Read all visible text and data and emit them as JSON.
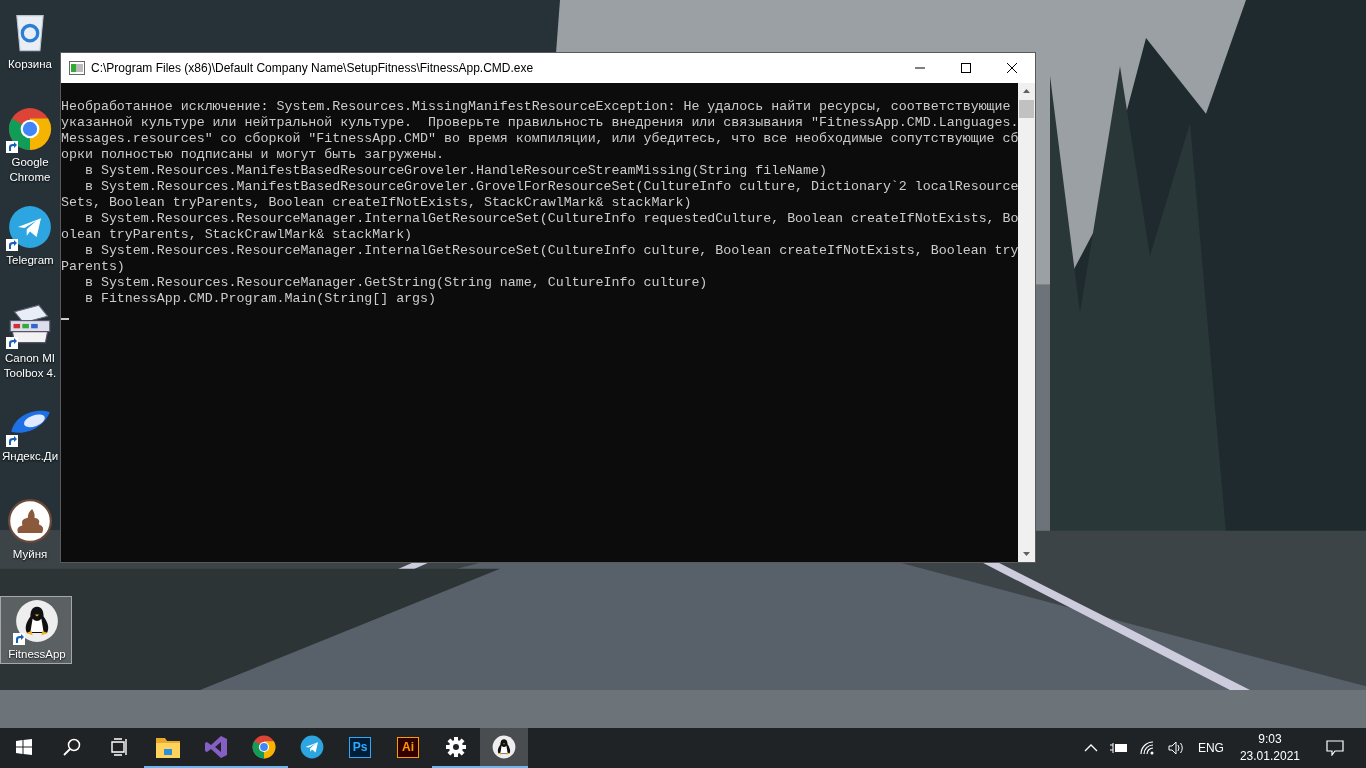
{
  "desktop_icons": [
    {
      "kind": "recycle-bin",
      "label": "Корзина",
      "shortcut": false,
      "selected": false
    },
    {
      "kind": "chrome",
      "label": "Google Chrome",
      "shortcut": true,
      "selected": false
    },
    {
      "kind": "telegram",
      "label": "Telegram",
      "shortcut": true,
      "selected": false
    },
    {
      "kind": "scanner",
      "label": "Canon MI Toolbox 4.",
      "shortcut": true,
      "selected": false
    },
    {
      "kind": "saucer",
      "label": "Яндекс.Ди",
      "shortcut": true,
      "selected": false
    },
    {
      "kind": "poop",
      "label": "Муйня",
      "shortcut": false,
      "selected": false
    },
    {
      "kind": "penguin",
      "label": "FitnessApp",
      "shortcut": true,
      "selected": true
    }
  ],
  "window": {
    "title": "C:\\Program Files (x86)\\Default Company Name\\SetupFitness\\FitnessApp.CMD.exe"
  },
  "console": {
    "lines": [
      "Необработанное исключение: System.Resources.MissingManifestResourceException: Не удалось найти ресурсы, соответствующие",
      "указанной культуре или нейтральной культуре.  Проверьте правильность внедрения или связывания \"FitnessApp.CMD.Languages.",
      "Messages.resources\" со сборкой \"FitnessApp.CMD\" во время компиляции, или убедитесь, что все необходимые сопутствующие сб",
      "орки полностью подписаны и могут быть загружены.",
      "   в System.Resources.ManifestBasedResourceGroveler.HandleResourceStreamMissing(String fileName)",
      "   в System.Resources.ManifestBasedResourceGroveler.GrovelForResourceSet(CultureInfo culture, Dictionary`2 localResource",
      "Sets, Boolean tryParents, Boolean createIfNotExists, StackCrawlMark& stackMark)",
      "   в System.Resources.ResourceManager.InternalGetResourceSet(CultureInfo requestedCulture, Boolean createIfNotExists, Bo",
      "olean tryParents, StackCrawlMark& stackMark)",
      "   в System.Resources.ResourceManager.InternalGetResourceSet(CultureInfo culture, Boolean createIfNotExists, Boolean try",
      "Parents)",
      "   в System.Resources.ResourceManager.GetString(String name, CultureInfo culture)",
      "   в FitnessApp.CMD.Program.Main(String[] args)"
    ]
  },
  "taskbar": {
    "buttons": [
      {
        "kind": "start",
        "running": false,
        "active": false
      },
      {
        "kind": "search",
        "running": false,
        "active": false
      },
      {
        "kind": "task-view",
        "running": false,
        "active": false
      },
      {
        "kind": "folder",
        "running": true,
        "active": false
      },
      {
        "kind": "visual-studio",
        "running": true,
        "active": false
      },
      {
        "kind": "chrome",
        "running": true,
        "active": false
      },
      {
        "kind": "telegram",
        "running": false,
        "active": false
      },
      {
        "kind": "ps",
        "label": "Ps",
        "running": false,
        "active": false
      },
      {
        "kind": "ai",
        "label": "Ai",
        "running": false,
        "active": false
      },
      {
        "kind": "gear",
        "running": true,
        "active": false
      },
      {
        "kind": "penguin",
        "running": true,
        "active": true
      }
    ],
    "tray": {
      "language": "ENG",
      "time": "9:03",
      "date": "23.01.2021"
    }
  }
}
